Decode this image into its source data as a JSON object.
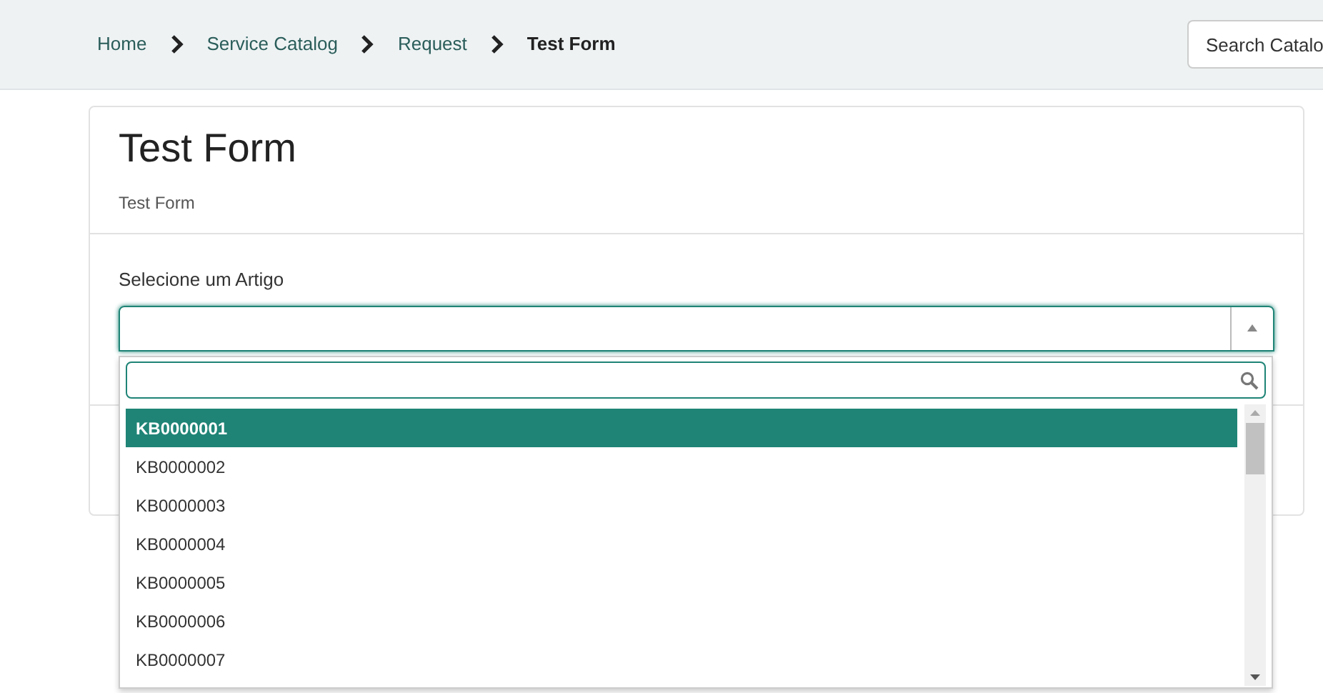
{
  "breadcrumb": [
    {
      "label": "Home",
      "current": false
    },
    {
      "label": "Service Catalog",
      "current": false
    },
    {
      "label": "Request",
      "current": false
    },
    {
      "label": "Test Form",
      "current": true
    }
  ],
  "search": {
    "placeholder": "Search Catalo"
  },
  "form": {
    "title": "Test Form",
    "subtitle": "Test Form"
  },
  "field": {
    "label": "Selecione um Artigo",
    "expanded": true
  },
  "dropdown": {
    "options": [
      {
        "label": "KB0000001",
        "selected": true
      },
      {
        "label": "KB0000002",
        "selected": false
      },
      {
        "label": "KB0000003",
        "selected": false
      },
      {
        "label": "KB0000004",
        "selected": false
      },
      {
        "label": "KB0000005",
        "selected": false
      },
      {
        "label": "KB0000006",
        "selected": false
      },
      {
        "label": "KB0000007",
        "selected": false
      }
    ]
  }
}
